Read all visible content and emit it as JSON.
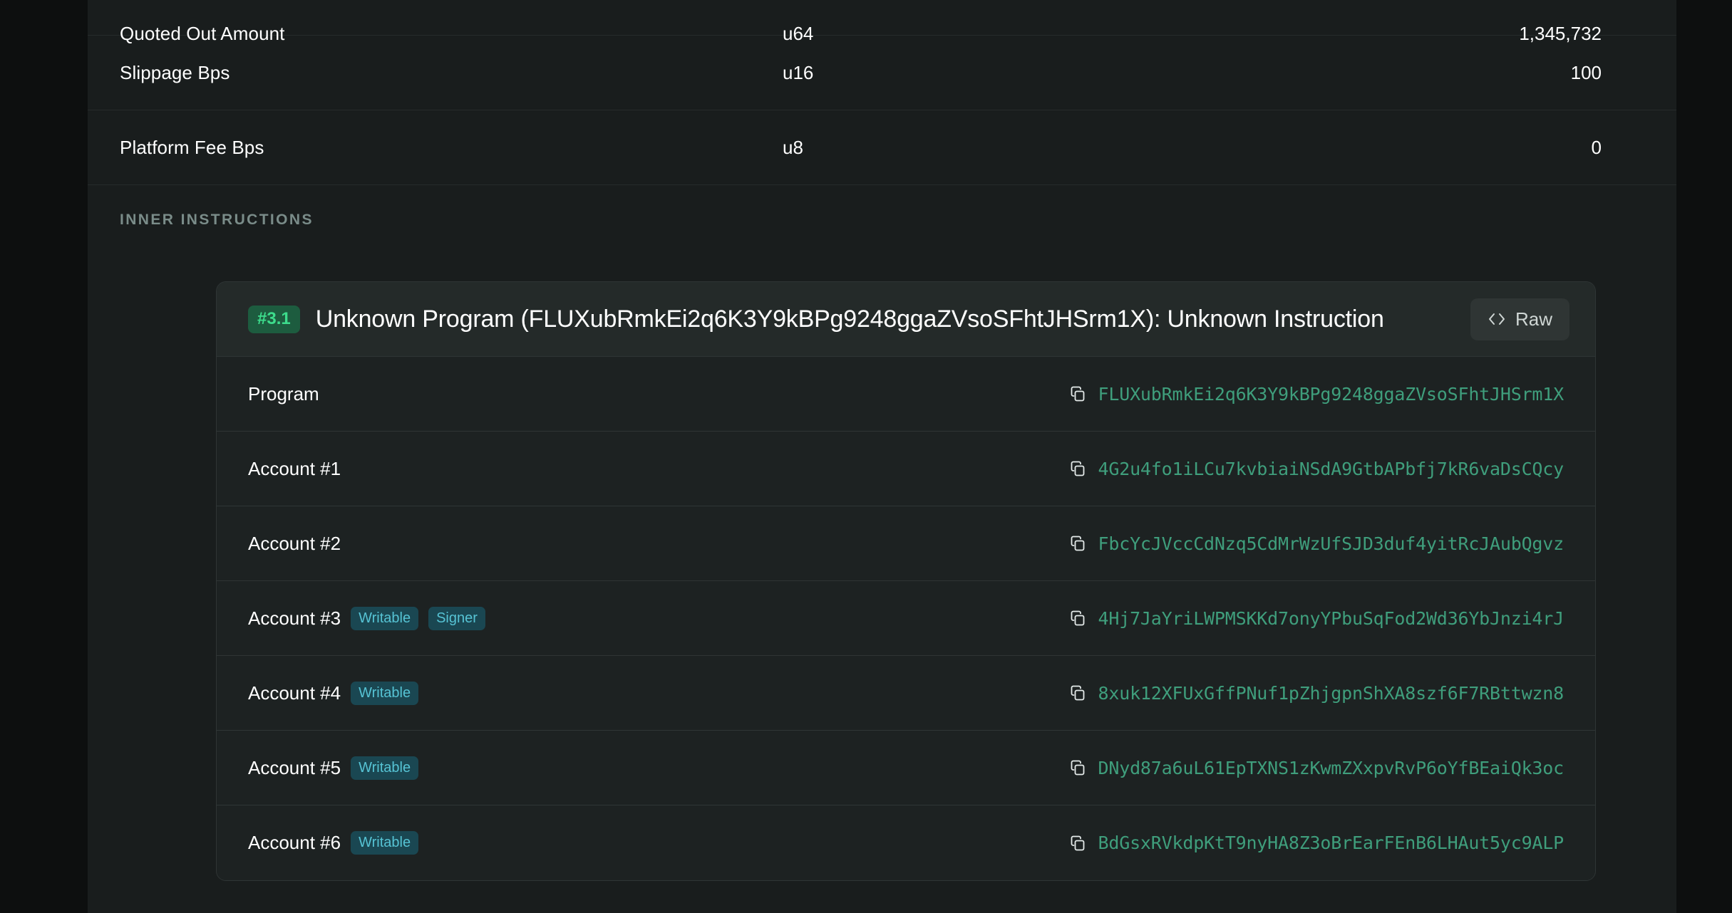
{
  "parsed_args": {
    "rows": [
      {
        "name": "Quoted Out Amount",
        "type": "u64",
        "value": "1,345,732"
      },
      {
        "name": "Slippage Bps",
        "type": "u16",
        "value": "100"
      },
      {
        "name": "Platform Fee Bps",
        "type": "u8",
        "value": "0"
      }
    ]
  },
  "section": {
    "inner_instructions_label": "INNER INSTRUCTIONS"
  },
  "instruction": {
    "index_badge": "#3.1",
    "title": "Unknown Program (FLUXubRmkEi2q6K3Y9kBPg9248ggaZVsoSFhtJHSrm1X): Unknown Instruction",
    "raw_button_label": "Raw",
    "code_icon": "code-brackets-icon",
    "accounts": [
      {
        "label": "Program",
        "tags": [],
        "address": "FLUXubRmkEi2q6K3Y9kBPg9248ggaZVsoSFhtJHSrm1X",
        "copy_icon": "copy-icon"
      },
      {
        "label": "Account #1",
        "tags": [],
        "address": "4G2u4fo1iLCu7kvbiaiNSdA9GtbAPbfj7kR6vaDsCQcy",
        "copy_icon": "copy-icon"
      },
      {
        "label": "Account #2",
        "tags": [],
        "address": "FbcYcJVccCdNzq5CdMrWzUfSJD3duf4yitRcJAubQgvz",
        "copy_icon": "copy-icon"
      },
      {
        "label": "Account #3",
        "tags": [
          "Writable",
          "Signer"
        ],
        "address": "4Hj7JaYriLWPMSKKd7onyYPbuSqFod2Wd36YbJnzi4rJ",
        "copy_icon": "copy-icon"
      },
      {
        "label": "Account #4",
        "tags": [
          "Writable"
        ],
        "address": "8xuk12XFUxGffPNuf1pZhjgpnShXA8szf6F7RBttwzn8",
        "copy_icon": "copy-icon"
      },
      {
        "label": "Account #5",
        "tags": [
          "Writable"
        ],
        "address": "DNyd87a6uL61EpTXNS1zKwmZXxpvRvP6oYfBEaiQk3oc",
        "copy_icon": "copy-icon"
      },
      {
        "label": "Account #6",
        "tags": [
          "Writable"
        ],
        "address": "BdGsxRVkdpKtT9nyHA8Z3oBrEarFEnB6LHAut5yc9ALP",
        "copy_icon": "copy-icon"
      }
    ]
  },
  "colors": {
    "page_background": "#0d0f0f",
    "panel_background": "#191d1d",
    "card_background": "#1d2222",
    "card_header_background": "#242a29",
    "address_green": "#3f9e7c",
    "badge_green_text": "#3ddc8c",
    "badge_green_bg": "#1d5c3f",
    "tag_text": "#56c3d4",
    "tag_bg": "#1a4752",
    "section_label": "#7a8c89"
  }
}
